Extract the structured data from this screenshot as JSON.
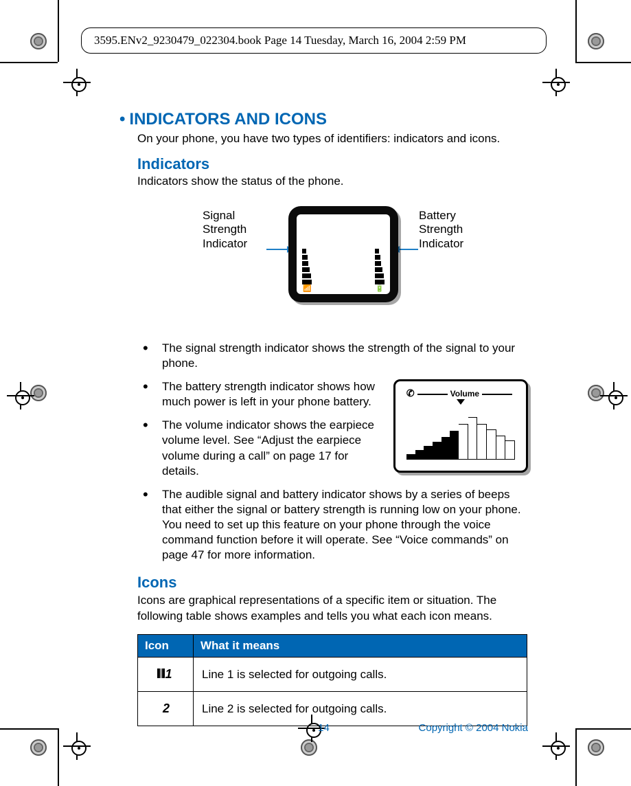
{
  "fileMeta": "3595.ENv2_9230479_022304.book  Page 14  Tuesday, March 16, 2004  2:59 PM",
  "section": {
    "title": "INDICATORS AND ICONS",
    "intro": "On your phone, you have two types of identifiers: indicators and icons."
  },
  "indicators": {
    "heading": "Indicators",
    "intro": "Indicators show the status of the phone.",
    "labels": {
      "signal": "Signal Strength Indicator",
      "battery": "Battery Strength Indicator"
    },
    "bullets": [
      "The signal strength indicator shows the strength of the signal to your phone.",
      "The battery strength indicator shows how much power is left in your phone battery.",
      "The volume indicator shows the earpiece volume level. See “Adjust the earpiece volume during a call” on page 17 for details.",
      "The audible signal and battery indicator shows by a series of beeps that either the signal or battery strength is running low on your phone. You need to set up this feature on your phone through the voice command function before it will operate. See “Voice commands” on page 47 for more information."
    ],
    "volumeLabel": "Volume"
  },
  "icons": {
    "heading": "Icons",
    "intro": "Icons are graphical representations of a specific item or situation. The following table shows examples and tells you what each icon means.",
    "table": {
      "headers": {
        "icon": "Icon",
        "meaning": "What it means"
      },
      "rows": [
        {
          "glyph": "1",
          "meaning": "Line 1 is selected for outgoing calls."
        },
        {
          "glyph": "2",
          "meaning": "Line 2 is selected for outgoing calls."
        }
      ]
    }
  },
  "footer": {
    "page": "14",
    "copyright": "Copyright © 2004 Nokia"
  }
}
